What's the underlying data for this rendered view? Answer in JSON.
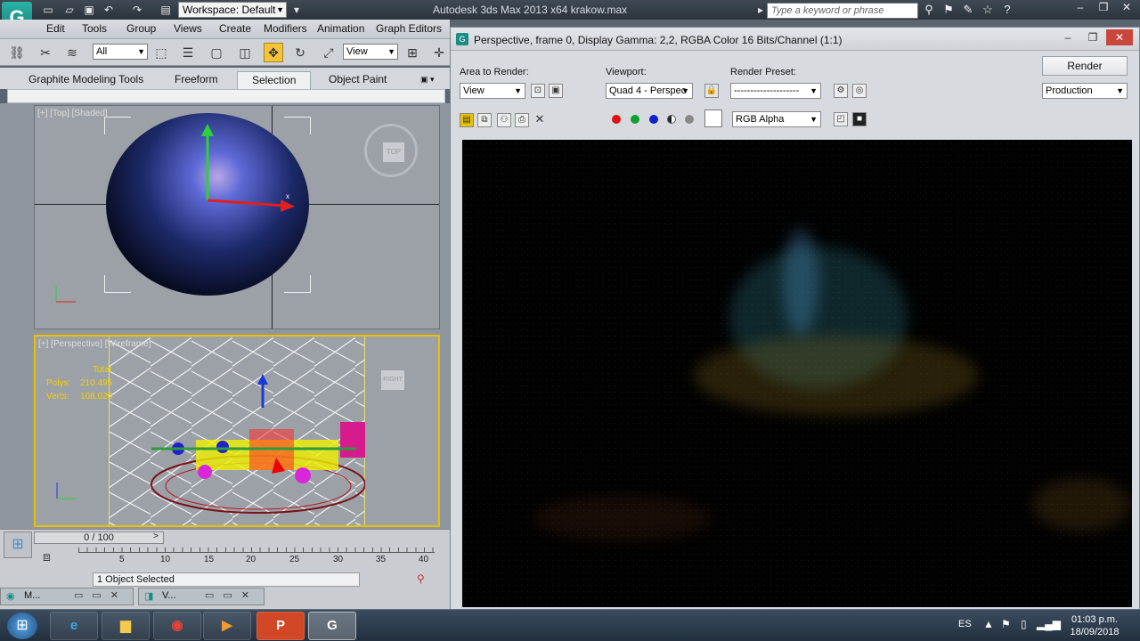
{
  "titlebar": {
    "workspace": "Workspace: Default",
    "app_title": "Autodesk 3ds Max  2013 x64     krakow.max",
    "search_placeholder": "Type a keyword or phrase"
  },
  "menu": [
    "Edit",
    "Tools",
    "Group",
    "Views",
    "Create",
    "Modifiers",
    "Animation",
    "Graph Editors"
  ],
  "toolbar": {
    "selection_filter": "All",
    "ref_coord": "View"
  },
  "ribbon": {
    "tabs": [
      "Graphite Modeling Tools",
      "Freeform",
      "Selection",
      "Object Paint"
    ],
    "active_tab": "Selection"
  },
  "viewports": {
    "top": {
      "label": "[+] [Top] [Shaded]",
      "navcube": "TOP"
    },
    "perspective": {
      "label": "[+] [Perspective] [Wireframe]",
      "navcube": "RIGHT",
      "stats_total": "Total",
      "polys_label": "Polys:",
      "polys_value": "210.495",
      "verts_label": "Verts:",
      "verts_value": "108.020"
    }
  },
  "timeline": {
    "slider": "0 / 100",
    "ticks": [
      "5",
      "10",
      "15",
      "20",
      "25",
      "30",
      "35",
      "40"
    ],
    "status": "1 Object Selected"
  },
  "mini_windows": [
    "M...",
    "V..."
  ],
  "render_window": {
    "title": "Perspective, frame 0, Display Gamma: 2,2, RGBA Color 16 Bits/Channel (1:1)",
    "area_label": "Area to Render:",
    "area_value": "View",
    "viewport_label": "Viewport:",
    "viewport_value": "Quad 4 - Perspec",
    "preset_label": "Render Preset:",
    "preset_value": "--------------------",
    "render_button": "Render",
    "mode_value": "Production",
    "channel_value": "RGB Alpha"
  },
  "taskbar": {
    "lang": "ES",
    "time": "01:03 p.m.",
    "date": "18/09/2018"
  },
  "colors": {
    "active_tool": "#f5c33b",
    "viewport_border_active": "#e8c100",
    "render_bg": "#020202",
    "close_red": "#c9463d"
  }
}
